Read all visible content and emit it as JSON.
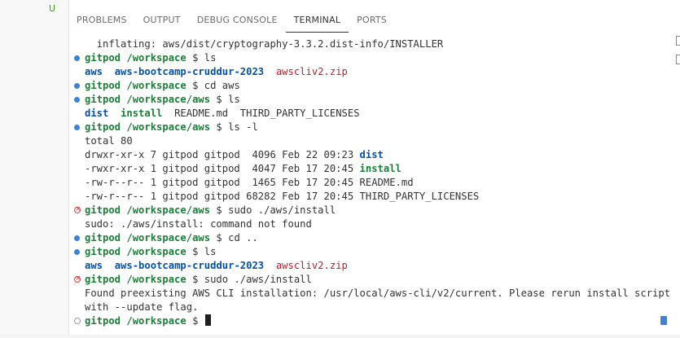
{
  "left_pane": {
    "git_status": "U"
  },
  "panel_tabs": [
    {
      "label": "PROBLEMS",
      "active": false
    },
    {
      "label": "OUTPUT",
      "active": false
    },
    {
      "label": "DEBUG CONSOLE",
      "active": false
    },
    {
      "label": "TERMINAL",
      "active": true
    },
    {
      "label": "PORTS",
      "active": false
    }
  ],
  "terminal": {
    "lines": [
      {
        "deco": "",
        "segments": [
          {
            "t": "  inflating: aws/dist/cryptography-3.3.2.dist-info/INSTALLER",
            "c": ""
          }
        ]
      },
      {
        "deco": "ok",
        "segments": [
          {
            "t": "gitpod /workspace",
            "c": "prompt"
          },
          {
            "t": " $ ls",
            "c": ""
          }
        ]
      },
      {
        "deco": "",
        "segments": [
          {
            "t": "aws",
            "c": "dir"
          },
          {
            "t": "  ",
            "c": ""
          },
          {
            "t": "aws-bootcamp-cruddur-2023",
            "c": "dir"
          },
          {
            "t": "  ",
            "c": ""
          },
          {
            "t": "awscliv2.zip",
            "c": "zip"
          }
        ]
      },
      {
        "deco": "ok",
        "segments": [
          {
            "t": "gitpod /workspace",
            "c": "prompt"
          },
          {
            "t": " $ cd aws",
            "c": ""
          }
        ]
      },
      {
        "deco": "ok",
        "segments": [
          {
            "t": "gitpod /workspace/aws",
            "c": "prompt"
          },
          {
            "t": " $ ls",
            "c": ""
          }
        ]
      },
      {
        "deco": "",
        "segments": [
          {
            "t": "dist",
            "c": "dir"
          },
          {
            "t": "  ",
            "c": ""
          },
          {
            "t": "install",
            "c": "exec"
          },
          {
            "t": "  README.md  THIRD_PARTY_LICENSES",
            "c": ""
          }
        ]
      },
      {
        "deco": "ok",
        "segments": [
          {
            "t": "gitpod /workspace/aws",
            "c": "prompt"
          },
          {
            "t": " $ ls -l",
            "c": ""
          }
        ]
      },
      {
        "deco": "",
        "segments": [
          {
            "t": "total 80",
            "c": ""
          }
        ]
      },
      {
        "deco": "",
        "segments": [
          {
            "t": "drwxr-xr-x 7 gitpod gitpod  4096 Feb 22 09:23 ",
            "c": ""
          },
          {
            "t": "dist",
            "c": "dir"
          }
        ]
      },
      {
        "deco": "",
        "segments": [
          {
            "t": "-rwxr-xr-x 1 gitpod gitpod  4047 Feb 17 20:45 ",
            "c": ""
          },
          {
            "t": "install",
            "c": "exec"
          }
        ]
      },
      {
        "deco": "",
        "segments": [
          {
            "t": "-rw-r--r-- 1 gitpod gitpod  1465 Feb 17 20:45 README.md",
            "c": ""
          }
        ]
      },
      {
        "deco": "",
        "segments": [
          {
            "t": "-rw-r--r-- 1 gitpod gitpod 68282 Feb 17 20:45 THIRD_PARTY_LICENSES",
            "c": ""
          }
        ]
      },
      {
        "deco": "err",
        "segments": [
          {
            "t": "gitpod /workspace/aws",
            "c": "prompt"
          },
          {
            "t": " $ sudo ./aws/install",
            "c": ""
          }
        ]
      },
      {
        "deco": "",
        "segments": [
          {
            "t": "sudo: ./aws/install: command not found",
            "c": ""
          }
        ]
      },
      {
        "deco": "ok",
        "segments": [
          {
            "t": "gitpod /workspace/aws",
            "c": "prompt"
          },
          {
            "t": " $ cd ..",
            "c": ""
          }
        ]
      },
      {
        "deco": "ok",
        "segments": [
          {
            "t": "gitpod /workspace",
            "c": "prompt"
          },
          {
            "t": " $ ls",
            "c": ""
          }
        ]
      },
      {
        "deco": "",
        "segments": [
          {
            "t": "aws",
            "c": "dir"
          },
          {
            "t": "  ",
            "c": ""
          },
          {
            "t": "aws-bootcamp-cruddur-2023",
            "c": "dir"
          },
          {
            "t": "  ",
            "c": ""
          },
          {
            "t": "awscliv2.zip",
            "c": "zip"
          }
        ]
      },
      {
        "deco": "err",
        "segments": [
          {
            "t": "gitpod /workspace",
            "c": "prompt"
          },
          {
            "t": " $ sudo ./aws/install",
            "c": ""
          }
        ]
      },
      {
        "deco": "",
        "segments": [
          {
            "t": "Found preexisting AWS CLI installation: /usr/local/aws-cli/v2/current. Please rerun install script",
            "c": ""
          }
        ]
      },
      {
        "deco": "",
        "segments": [
          {
            "t": "with --update flag.",
            "c": ""
          }
        ]
      },
      {
        "deco": "idle",
        "segments": [
          {
            "t": "gitpod /workspace",
            "c": "prompt"
          },
          {
            "t": " $ ",
            "c": ""
          }
        ],
        "cursor": true
      }
    ]
  },
  "colors": {
    "prompt": "#1a7f37",
    "directory": "#0451a5",
    "archive": "#c5192d",
    "decoration_success": "#3a84d8",
    "decoration_error": "#e23c3c"
  }
}
